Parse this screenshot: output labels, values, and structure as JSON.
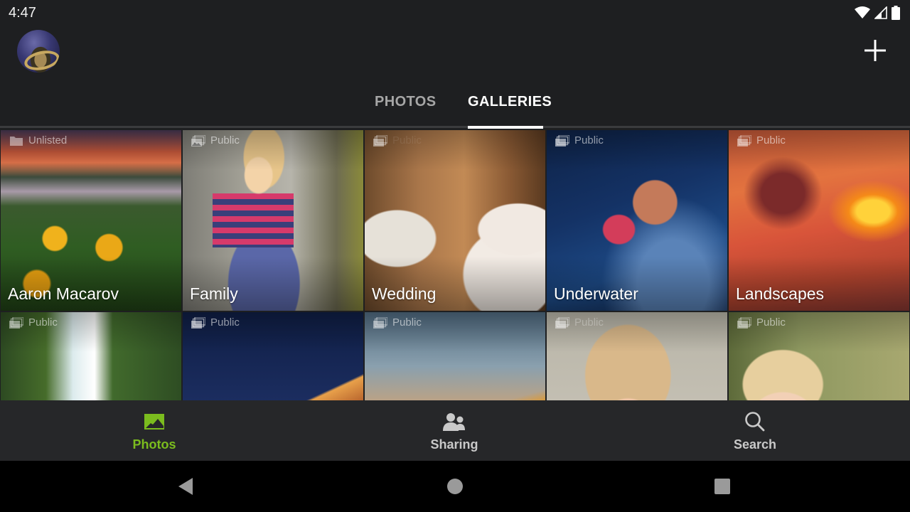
{
  "status_bar": {
    "time": "4:47",
    "icons": [
      "wifi-icon",
      "cellular-signal-icon",
      "battery-icon"
    ]
  },
  "app_bar": {
    "avatar": "user-avatar",
    "add_icon": "plus-icon"
  },
  "tabs": [
    {
      "label": "PHOTOS",
      "active": false
    },
    {
      "label": "GALLERIES",
      "active": true
    }
  ],
  "galleries": [
    {
      "title": "Aaron Macarov",
      "visibility": "Unlisted",
      "visibility_icon": "folder-icon"
    },
    {
      "title": "Family",
      "visibility": "Public",
      "visibility_icon": "gallery-icon"
    },
    {
      "title": "Wedding",
      "visibility": "Public",
      "visibility_icon": "gallery-icon"
    },
    {
      "title": "Underwater",
      "visibility": "Public",
      "visibility_icon": "gallery-icon"
    },
    {
      "title": "Landscapes",
      "visibility": "Public",
      "visibility_icon": "gallery-icon"
    },
    {
      "title": "",
      "visibility": "Public",
      "visibility_icon": "gallery-icon"
    },
    {
      "title": "",
      "visibility": "Public",
      "visibility_icon": "gallery-icon"
    },
    {
      "title": "",
      "visibility": "Public",
      "visibility_icon": "gallery-icon"
    },
    {
      "title": "",
      "visibility": "Public",
      "visibility_icon": "gallery-icon"
    },
    {
      "title": "",
      "visibility": "Public",
      "visibility_icon": "gallery-icon"
    }
  ],
  "bottom_nav": [
    {
      "label": "Photos",
      "icon": "landscape-photo-icon",
      "active": true
    },
    {
      "label": "Sharing",
      "icon": "people-icon",
      "active": false
    },
    {
      "label": "Search",
      "icon": "search-icon",
      "active": false
    }
  ],
  "system_nav": [
    "back-button",
    "home-button",
    "recents-button"
  ],
  "colors": {
    "accent": "#7bbc1e",
    "background": "#1e1f21",
    "bottom_nav_bg": "#262729"
  }
}
